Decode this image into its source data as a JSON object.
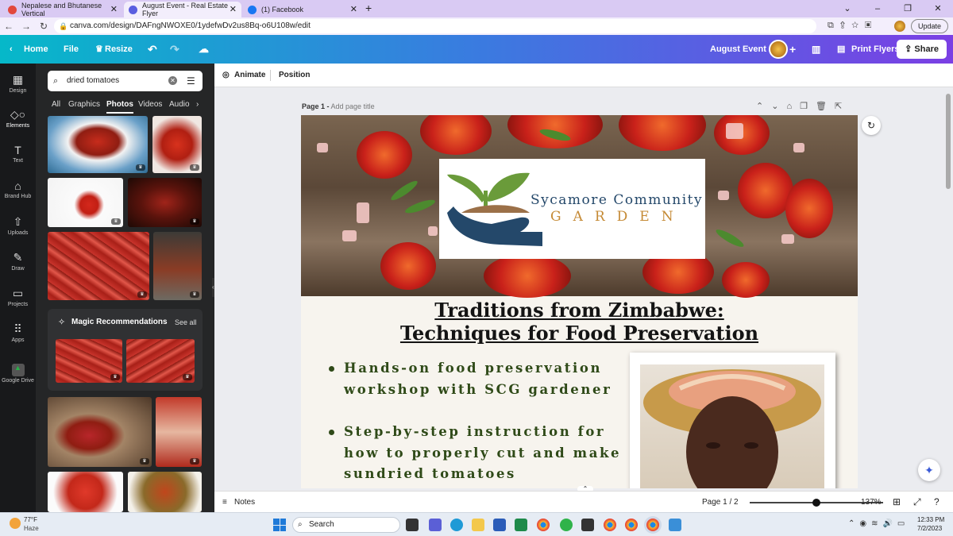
{
  "browser": {
    "tabs": [
      {
        "title": "Nepalese and Bhutanese Vertical",
        "icon": "canva-icon"
      },
      {
        "title": "August Event - Real Estate Flyer",
        "icon": "canva-icon",
        "active": true
      },
      {
        "title": "(1) Facebook",
        "icon": "facebook-icon"
      }
    ],
    "url": "canva.com/design/DAFngNWOXE0/1ydefwDv2us8Bq-o6U108w/edit",
    "update_label": "Update"
  },
  "canva_header": {
    "home": "Home",
    "file": "File",
    "resize": "Resize",
    "design_title": "August Event",
    "print": "Print Flyers",
    "share": "Share"
  },
  "rail": [
    "Design",
    "Elements",
    "Text",
    "Brand Hub",
    "Uploads",
    "Draw",
    "Projects",
    "Apps",
    "Google Drive"
  ],
  "panel": {
    "search_value": "dried tomatoes",
    "tabs": [
      "All",
      "Graphics",
      "Photos",
      "Videos",
      "Audio"
    ],
    "magic_title": "Magic Recommendations",
    "see_all": "See all"
  },
  "toolbar": {
    "animate": "Animate",
    "position": "Position"
  },
  "page": {
    "label": "Page 1 -",
    "placeholder": "Add page title"
  },
  "flyer": {
    "logo_line1": "Sycamore Community",
    "logo_line2": "GARDEN",
    "title_line1": "Traditions from Zimbabwe:",
    "title_line2": "Techniques for Food Preservation",
    "bullets": [
      {
        "line1": "Hands-on food preservation",
        "line2": "workshop with SCG gardener",
        "line3": ""
      },
      {
        "line1": "Step-by-step instruction for",
        "line2": "how to properly cut and make",
        "line3": "sundried tomatoes"
      }
    ]
  },
  "bottom": {
    "notes": "Notes",
    "page_count": "Page 1 / 2",
    "zoom": "137%"
  },
  "taskbar": {
    "weather_temp": "77°F",
    "weather_desc": "Haze",
    "search": "Search",
    "time": "12:33 PM",
    "date": "7/2/2023"
  },
  "colors": {
    "canva_gradient_start": "#06b8c9",
    "canva_gradient_end": "#7b3fe4",
    "flyer_green": "#2f4a18",
    "logo_blue": "#24486a",
    "logo_gold": "#c58a35"
  }
}
